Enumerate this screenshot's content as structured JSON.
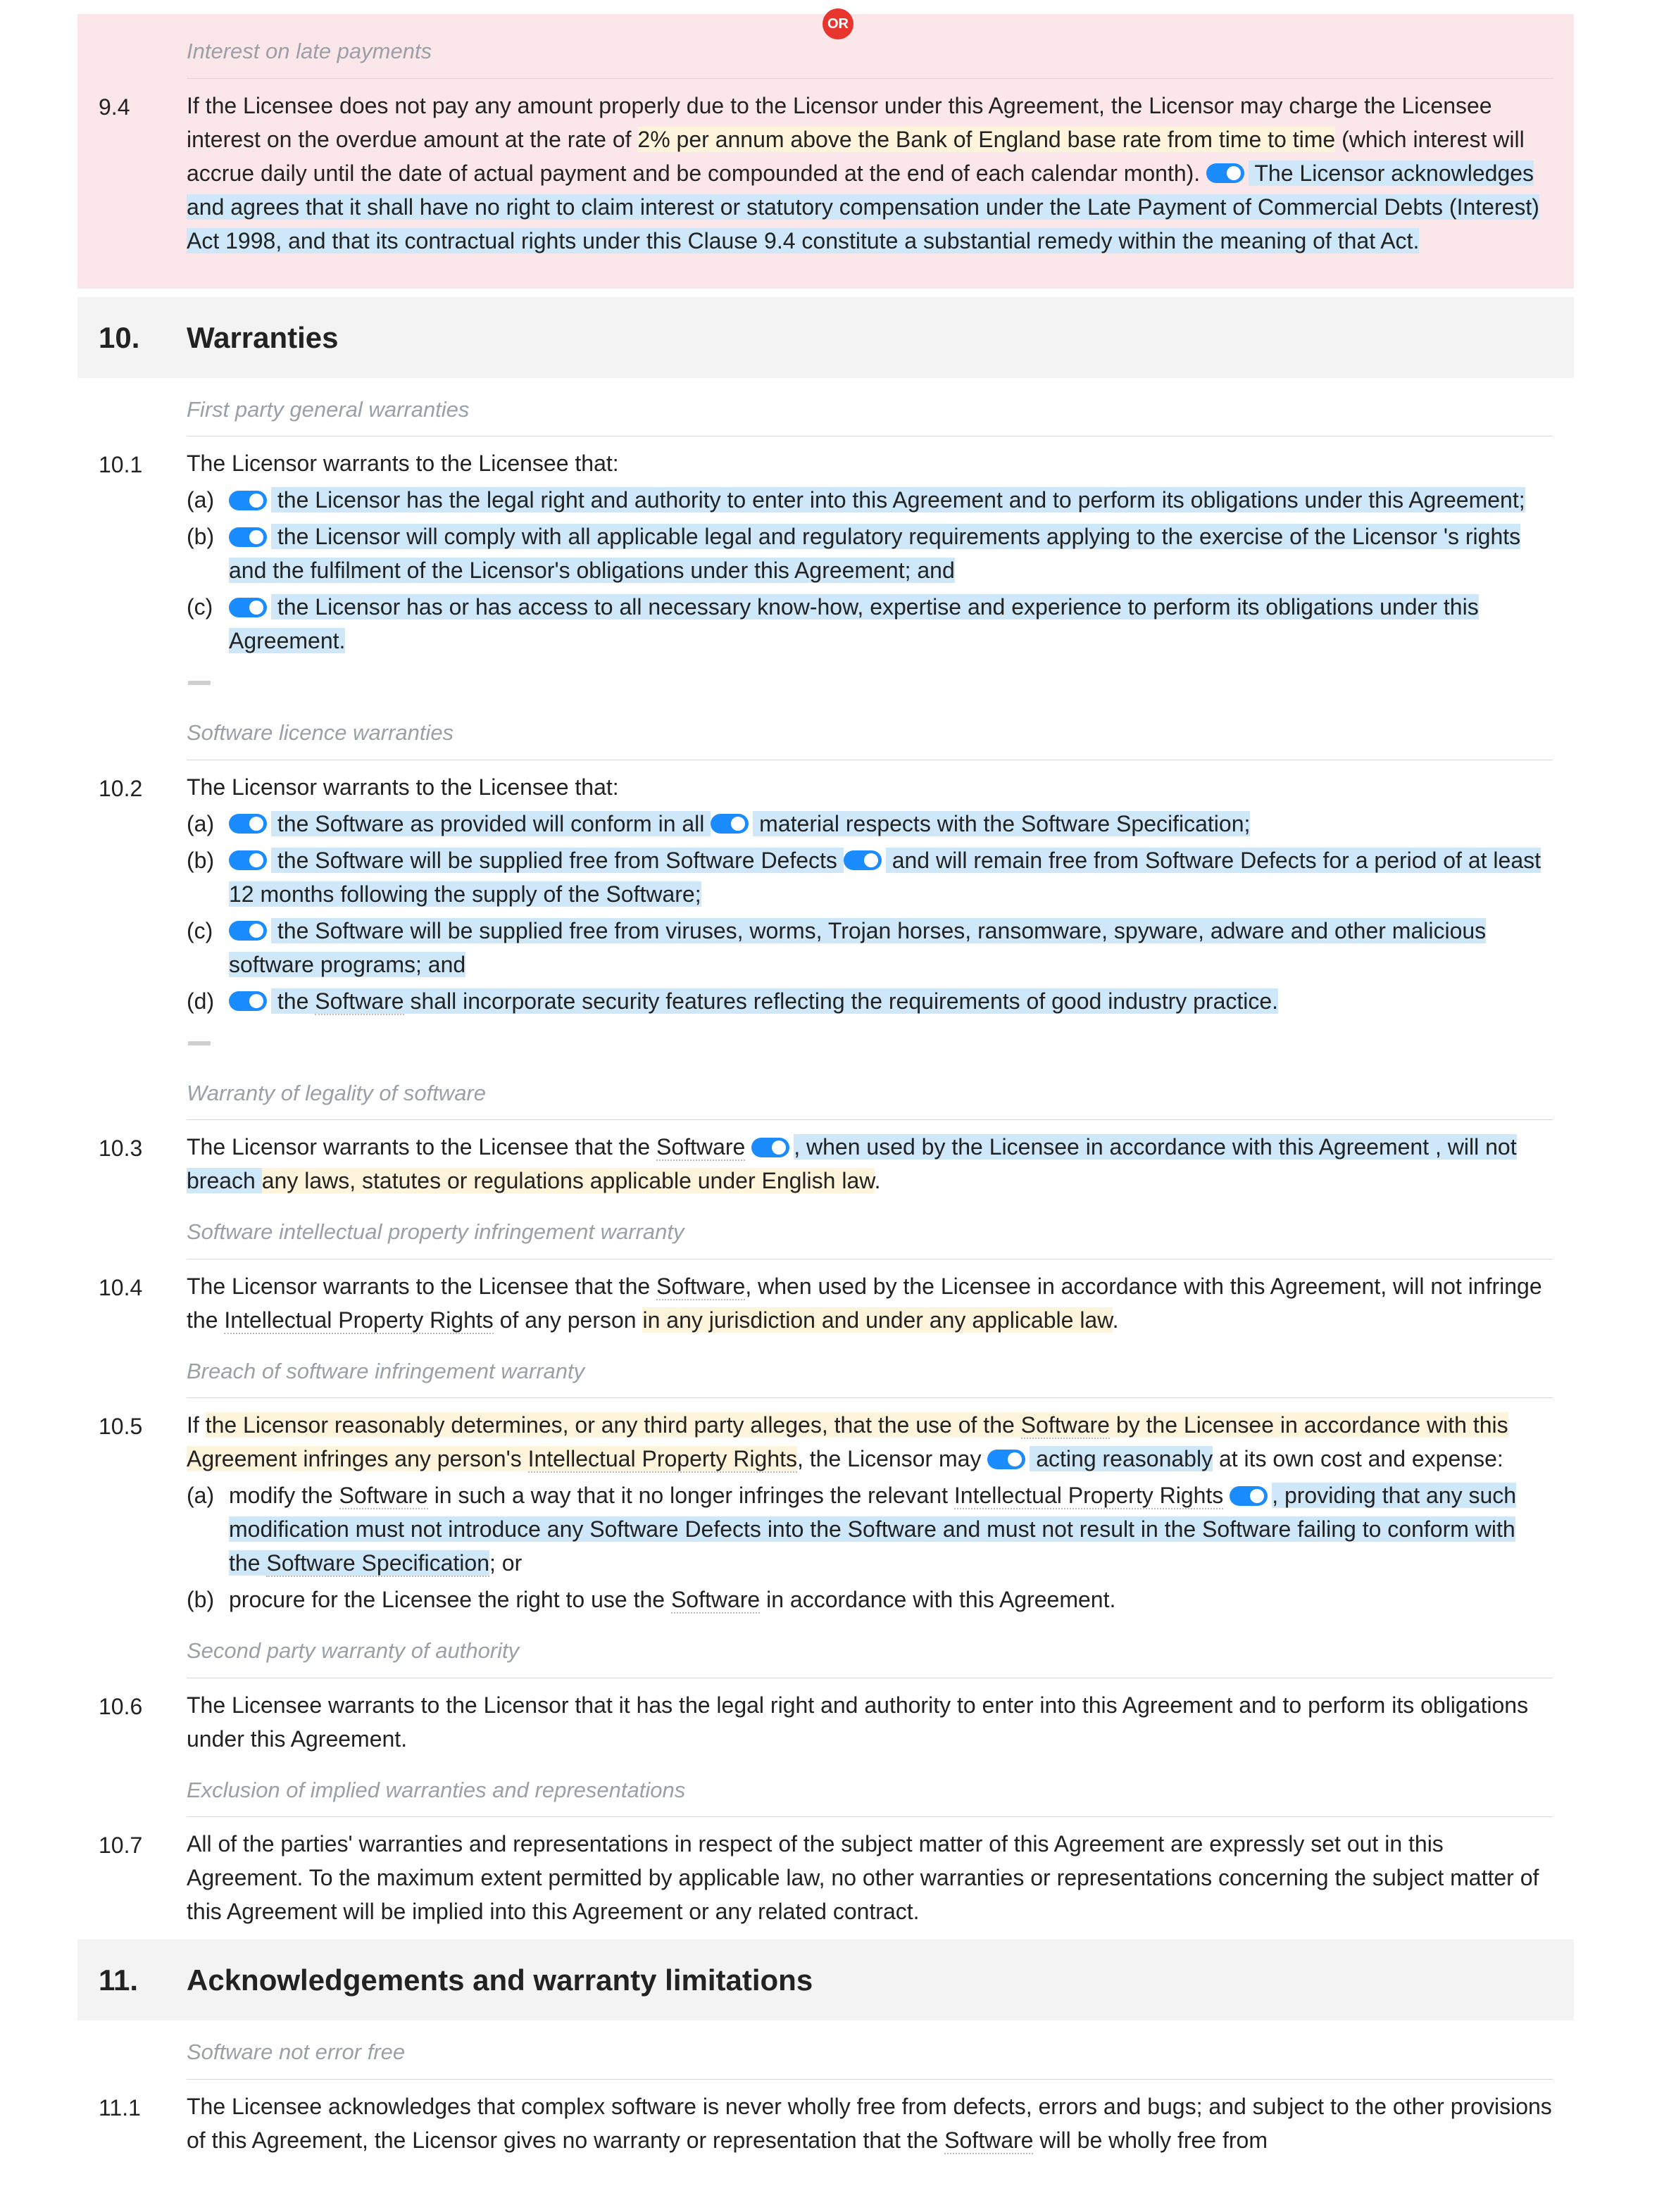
{
  "or_badge": "OR",
  "c94": {
    "note": "Interest on late payments",
    "num": "9.4",
    "t1": "If the Licensee does not pay any amount properly due to the Licensor under this Agreement, the Licensor may charge the Licensee interest on the overdue amount at the rate of ",
    "t2": "2% per annum above the Bank of England base rate from time to time",
    "t3": " (which interest will accrue daily until the date of actual payment and be compounded at the end of each calendar month). ",
    "t4": " The Licensor acknowledges and agrees that it shall have no right to claim interest or statutory compensation under the Late Payment of Commercial Debts (Interest) Act 1998, and that its contractual rights under this Clause 9.4 constitute a substantial remedy within the meaning of that Act."
  },
  "s10": {
    "num": "10.",
    "title": "Warranties"
  },
  "c101": {
    "note": "First party general warranties",
    "num": "10.1",
    "lead": "The Licensor warrants to the Licensee that:",
    "a": " the Licensor has the legal right and authority to enter into this Agreement and to perform its obligations under this Agreement;",
    "b": " the Licensor will comply with all applicable legal and regulatory requirements applying to the exercise of the Licensor 's rights and the fulfilment of the Licensor's obligations under this Agreement; and",
    "c": " the Licensor has or has access to all necessary know-how, expertise and experience to perform its obligations under this Agreement."
  },
  "c102": {
    "note": "Software licence warranties",
    "num": "10.2",
    "lead": "The Licensor warrants to the Licensee that:",
    "a1": " the Software as provided will conform in all ",
    "a2": " material respects with the Software Specification;",
    "b1": " the Software will be supplied free from Software Defects ",
    "b2": " and will remain free from Software Defects for a period of at least 12 months following the supply of the Software;",
    "c": " the Software will be supplied free from viruses, worms, Trojan horses, ransomware, spyware, adware and other malicious software programs; and",
    "d1": " the ",
    "d2": "Software",
    "d3": " shall incorporate security features reflecting the requirements of good industry practice."
  },
  "c103": {
    "note": "Warranty of legality of software",
    "num": "10.3",
    "t1": "The Licensor warrants to the Licensee that the ",
    "t2": "Software",
    "t3": " ",
    "t4": ", when used by the Licensee in accordance with this Agreement , will not breach ",
    "t5": "any laws, statutes or regulations applicable under English law",
    "t6": "."
  },
  "c104": {
    "note": "Software intellectual property infringement warranty",
    "num": "10.4",
    "t1": "The Licensor warrants to the Licensee that the ",
    "t2": "Software",
    "t3": ", when used by the Licensee in accordance with this Agreement, will not infringe the ",
    "t4": "Intellectual Property Rights",
    "t5": " of any person ",
    "t6": "in any jurisdiction and under any applicable law",
    "t7": "."
  },
  "c105": {
    "note": "Breach of software infringement warranty",
    "num": "10.5",
    "lead1": "If ",
    "lead2": "the Licensor reasonably determines, or any third party alleges, that the use of the ",
    "lead3": "Software",
    "lead4": " by the Licensee in accordance with this Agreement infringes any person's ",
    "lead5": "Intellectual Property Rights",
    "lead6": ", the Licensor may ",
    "lead7": " acting reasonably",
    "lead8": " at its own cost and expense:",
    "a1": "modify the ",
    "a2": "Software",
    "a3": " in such a way that it no longer infringes the relevant ",
    "a4": "Intellectual Property Rights",
    "a5": " ",
    "a6": ", providing that any such modification must not introduce any Software Defects into the Software and must not result in the Software failing to conform with the ",
    "a7": "Software Specification",
    "a8": "; or",
    "b1": "procure for the Licensee the right to use the ",
    "b2": "Software",
    "b3": " in accordance with this Agreement."
  },
  "c106": {
    "note": "Second party warranty of authority",
    "num": "10.6",
    "body": "The Licensee warrants to the Licensor that it has the legal right and authority to enter into this Agreement and to perform its obligations under this Agreement."
  },
  "c107": {
    "note": "Exclusion of implied warranties and representations",
    "num": "10.7",
    "body": "All of the parties' warranties and representations in respect of the subject matter of this Agreement are expressly set out in this Agreement. To the maximum extent permitted by applicable law, no other warranties or representations concerning the subject matter of this Agreement will be implied into this Agreement or any related contract."
  },
  "s11": {
    "num": "11.",
    "title": "Acknowledgements and warranty limitations"
  },
  "c111": {
    "note": "Software not error free",
    "num": "11.1",
    "t1": "The Licensee acknowledges that complex software is never wholly free from defects, errors and bugs; and subject to the other provisions of this Agreement, the Licensor gives no warranty or representation that the ",
    "t2": "Software",
    "t3": " will be wholly free from"
  },
  "letters": {
    "a": "(a)",
    "b": "(b)",
    "c": "(c)",
    "d": "(d)"
  }
}
